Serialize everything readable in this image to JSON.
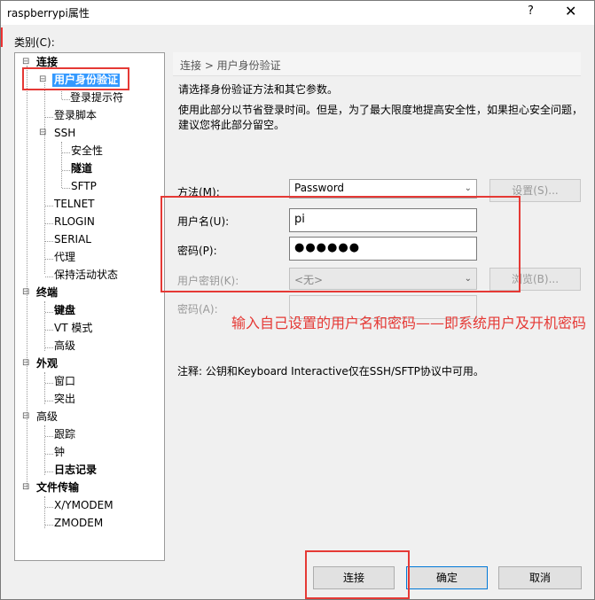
{
  "window": {
    "title": "raspberrypi属性",
    "help_label": "?",
    "close_label": "✕"
  },
  "category_label": "类别(C):",
  "tree": {
    "items": [
      {
        "label": "连接",
        "bold": true
      },
      {
        "label": "用户身份验证",
        "bold": true,
        "selected": true
      },
      {
        "label": "登录提示符"
      },
      {
        "label": "登录脚本"
      },
      {
        "label": "SSH"
      },
      {
        "label": "安全性"
      },
      {
        "label": "隧道",
        "bold": true
      },
      {
        "label": "SFTP"
      },
      {
        "label": "TELNET"
      },
      {
        "label": "RLOGIN"
      },
      {
        "label": "SERIAL"
      },
      {
        "label": "代理"
      },
      {
        "label": "保持活动状态"
      },
      {
        "label": "终端",
        "bold": true
      },
      {
        "label": "键盘",
        "bold": true
      },
      {
        "label": "VT 模式"
      },
      {
        "label": "高级"
      },
      {
        "label": "外观",
        "bold": true
      },
      {
        "label": "窗口"
      },
      {
        "label": "突出"
      },
      {
        "label": "高级"
      },
      {
        "label": "跟踪"
      },
      {
        "label": "钟"
      },
      {
        "label": "日志记录",
        "bold": true
      },
      {
        "label": "文件传输",
        "bold": true
      },
      {
        "label": "X/YMODEM"
      },
      {
        "label": "ZMODEM"
      }
    ]
  },
  "breadcrumb": "连接 > 用户身份验证",
  "description": {
    "line1": "请选择身份验证方法和其它参数。",
    "line2": "使用此部分以节省登录时间。但是，为了最大限度地提高安全性，如果担心安全问题，",
    "line3": "建议您将此部分留空。"
  },
  "form": {
    "method_label": "方法(M):",
    "method_value": "Password",
    "setup_button": "设置(S)...",
    "username_label": "用户名(U):",
    "username_value": "pi",
    "password_label": "密码(P):",
    "password_value": "●●●●●●",
    "userkey_label": "用户密钥(K):",
    "userkey_value": "<无>",
    "browse_button": "浏览(B)...",
    "passphrase_label": "密码(A):",
    "passphrase_value": ""
  },
  "annotation": "输入自己设置的用户名和密码——即系统用户及开机密码",
  "note": "注释: 公钥和Keyboard Interactive仅在SSH/SFTP协议中可用。",
  "buttons": {
    "connect": "连接",
    "ok": "确定",
    "cancel": "取消"
  },
  "colors": {
    "annotation_red": "#e53935",
    "selection_blue": "#3399ff",
    "default_button_border": "#0078d7"
  }
}
